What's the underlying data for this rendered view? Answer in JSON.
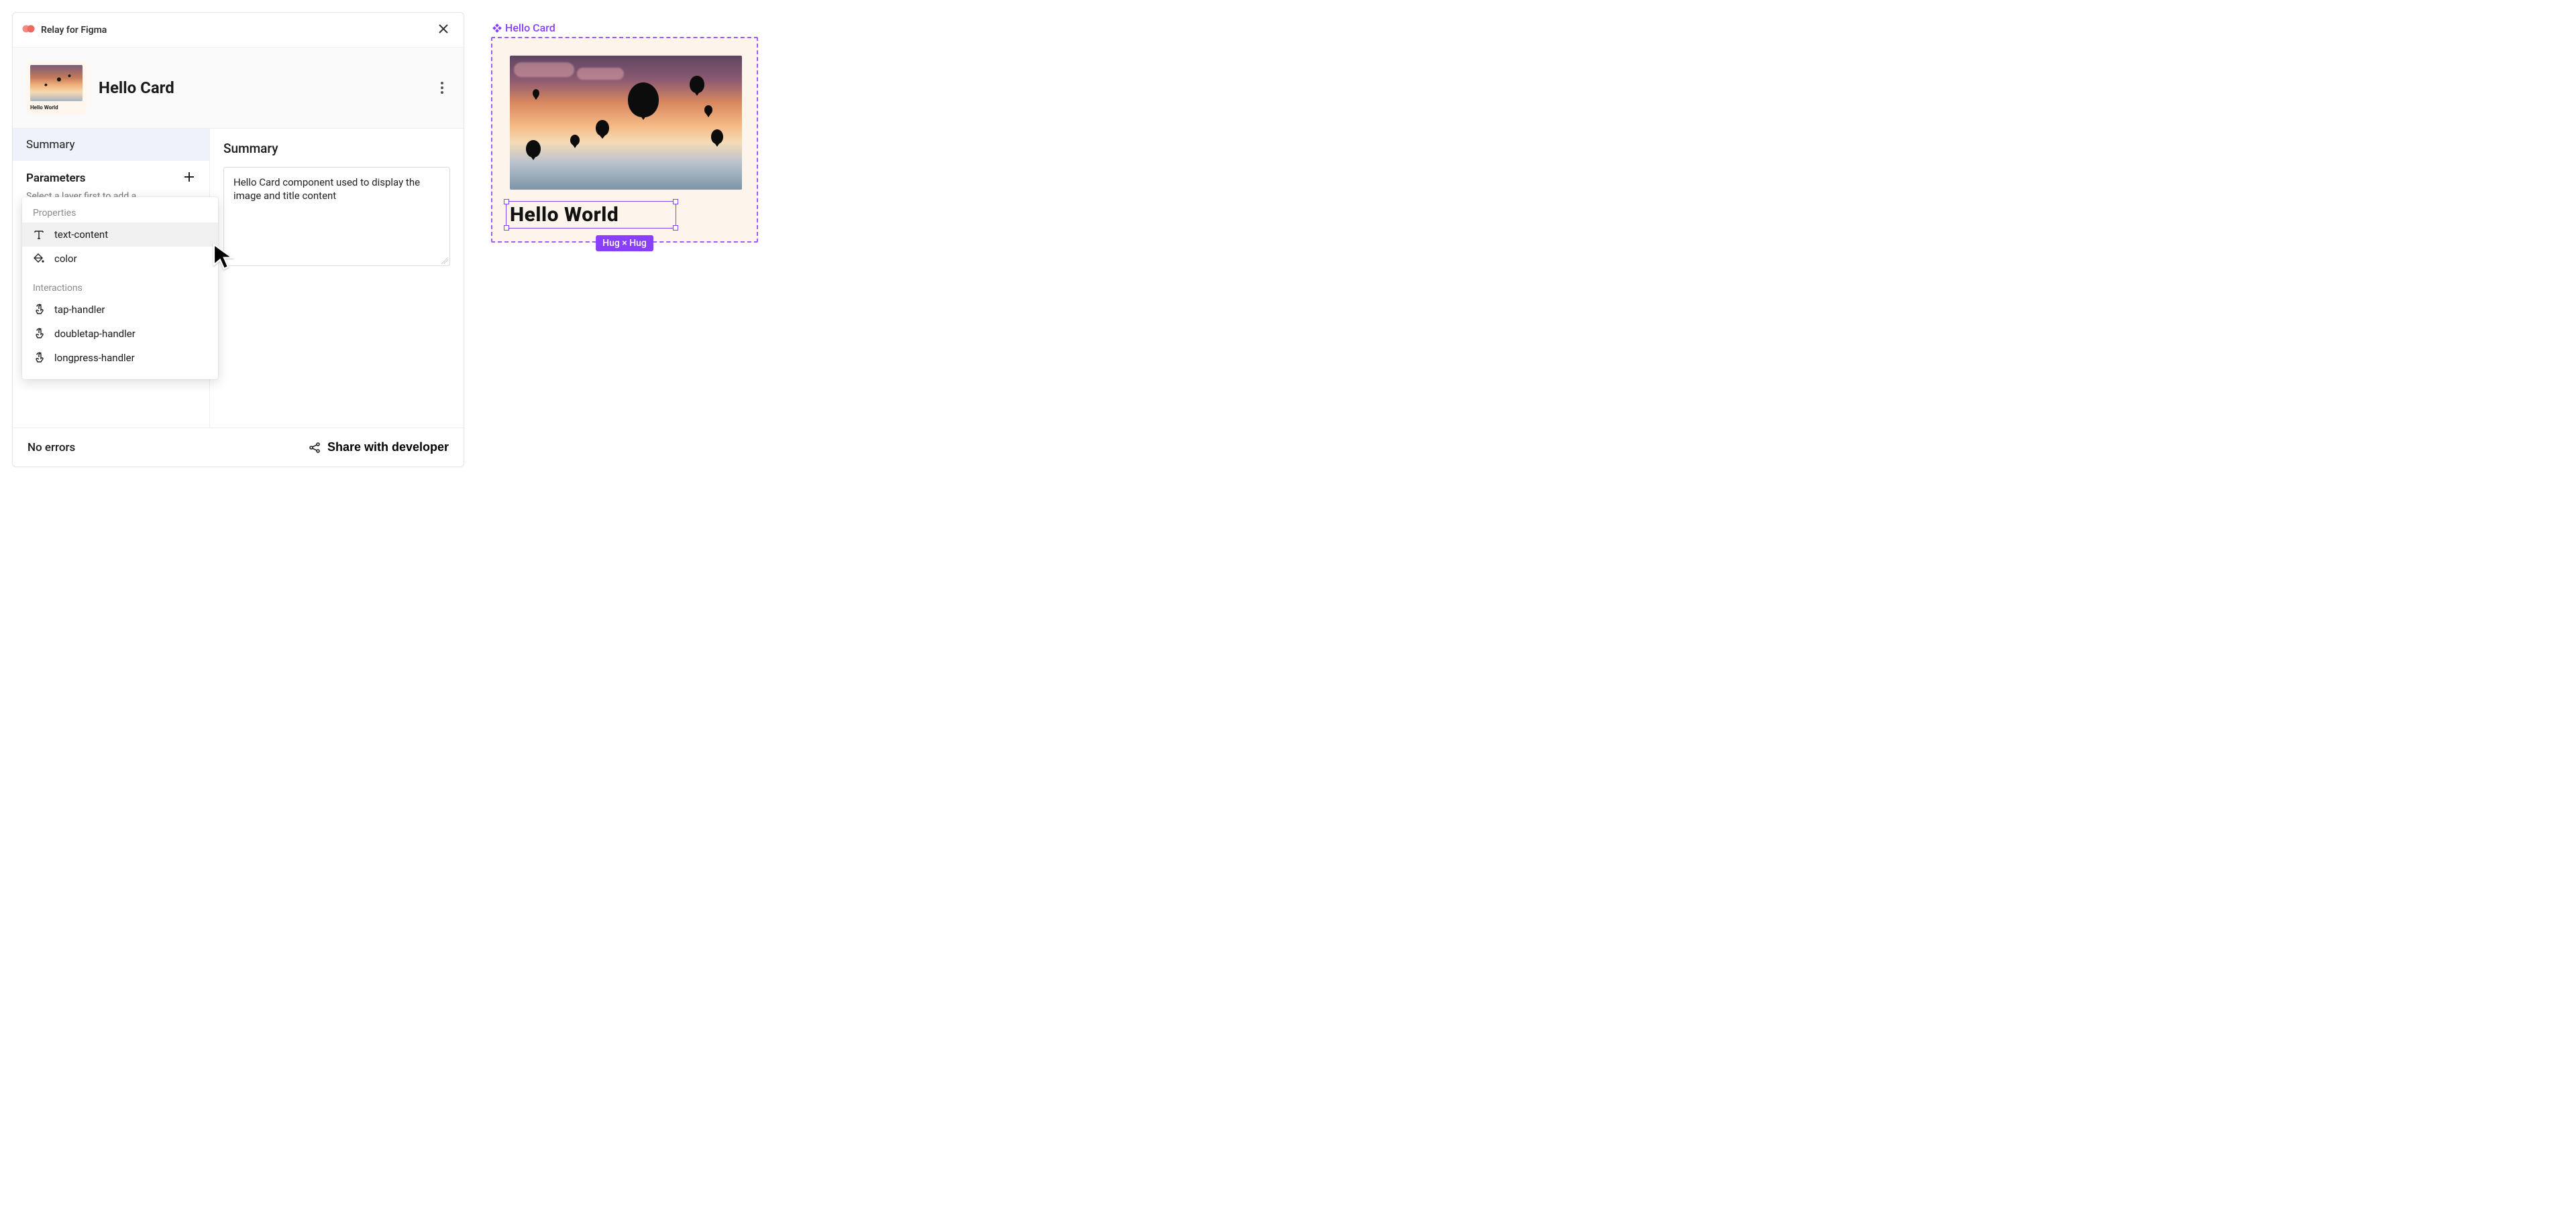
{
  "plugin_title": "Relay for Figma",
  "component_title": "Hello Card",
  "thumb_label": "Hello World",
  "sidebar": {
    "summary": "Summary",
    "parameters": "Parameters",
    "hint": "Select a layer first to add a"
  },
  "main": {
    "title": "Summary",
    "summary_text": "Hello Card component used to display the image and title content"
  },
  "dropdown": {
    "section_properties": "Properties",
    "section_interactions": "Interactions",
    "items_properties": [
      "text-content",
      "color"
    ],
    "items_interactions": [
      "tap-handler",
      "doubletap-handler",
      "longpress-handler"
    ]
  },
  "footer": {
    "status": "No errors",
    "share": "Share with developer"
  },
  "canvas": {
    "label": "Hello Card",
    "text": "Hello World",
    "size_badge": "Hug × Hug"
  },
  "colors": {
    "figma_purple": "#8a3ffc",
    "cream": "#fdf5ec"
  }
}
